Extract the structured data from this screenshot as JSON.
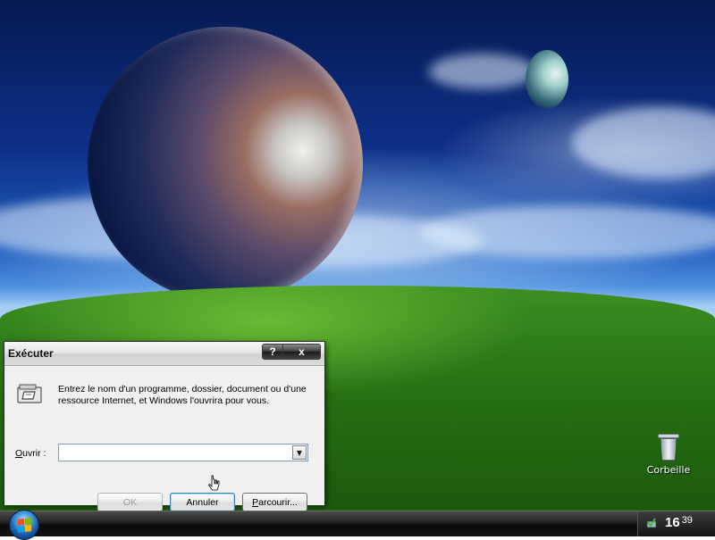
{
  "desktop": {
    "icons": [
      {
        "label": "Corbeille",
        "icon": "recycle-bin-icon"
      }
    ]
  },
  "run_dialog": {
    "title": "Exécuter",
    "help_label": "?",
    "close_label": "x",
    "description": "Entrez le nom d'un programme, dossier, document ou d'une ressource Internet, et Windows l'ouvrira pour vous.",
    "open_label_first": "O",
    "open_label_rest": "uvrir :",
    "open_value": "",
    "ok_label": "OK",
    "cancel_label": "Annuler",
    "browse_label_first": "P",
    "browse_label_rest": "arcourir..."
  },
  "taskbar": {
    "clock_hour": "16",
    "clock_minute": "39"
  }
}
